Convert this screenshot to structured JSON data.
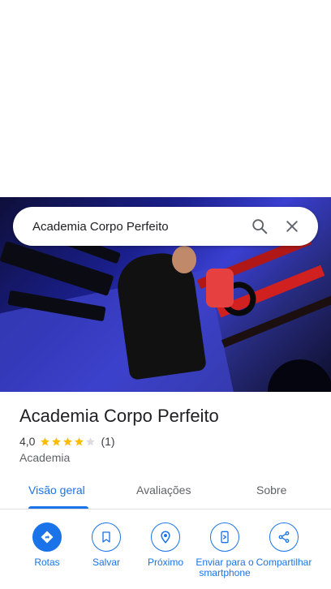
{
  "search": {
    "query": "Academia Corpo Perfeito"
  },
  "place": {
    "name": "Academia Corpo Perfeito",
    "rating_value": "4,0",
    "rating_stars": 4,
    "rating_max": 5,
    "review_count": "(1)",
    "category": "Academia"
  },
  "tabs": [
    {
      "label": "Visão geral",
      "active": true
    },
    {
      "label": "Avaliações",
      "active": false
    },
    {
      "label": "Sobre",
      "active": false
    }
  ],
  "actions": [
    {
      "label": "Rotas",
      "icon": "directions-icon"
    },
    {
      "label": "Salvar",
      "icon": "bookmark-icon"
    },
    {
      "label": "Próximo",
      "icon": "nearby-icon"
    },
    {
      "label": "Enviar para o smartphone",
      "icon": "send-to-phone-icon"
    },
    {
      "label": "Compartilhar",
      "icon": "share-icon"
    }
  ],
  "colors": {
    "accent": "#1a73e8",
    "star": "#fbbc04",
    "star_empty": "#dadce0"
  }
}
